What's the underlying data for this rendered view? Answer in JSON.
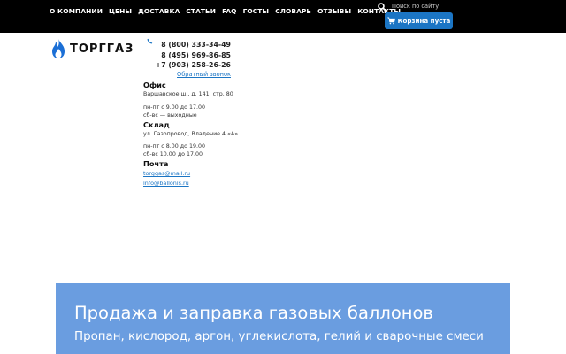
{
  "nav": {
    "items": [
      {
        "label": "О КОМПАНИИ"
      },
      {
        "label": "ЦЕНЫ"
      },
      {
        "label": "ДОСТАВКА"
      },
      {
        "label": "СТАТЬИ"
      },
      {
        "label": "FAQ"
      },
      {
        "label": "ГОСТЫ"
      },
      {
        "label": "СЛОВАРЬ"
      },
      {
        "label": "ОТЗЫВЫ"
      },
      {
        "label": "КОНТАКТЫ"
      }
    ]
  },
  "search": {
    "placeholder": "Поиск по сайту",
    "icon": "search-icon"
  },
  "cart": {
    "label": "Корзина пуста",
    "icon": "cart-icon",
    "color": "#1b75c4"
  },
  "logo": {
    "text": "ТОРГГАЗ",
    "icon": "flame-icon"
  },
  "contacts": {
    "phones": [
      "8 (800) 333-34-49",
      "8 (495) 969-86-85",
      "+7 (903) 258-26-26"
    ],
    "callback": "Обратный звонок",
    "office": {
      "title": "Офис",
      "address": "Варшавское ш., д. 141, стр. 80",
      "hours1": "пн-пт с 9.00 до 17.00",
      "hours2": "сб-вс — выходные"
    },
    "warehouse": {
      "title": "Склад",
      "address": "ул. Газопровод, Владение 4 «А»",
      "hours1": "пн-пт с 8.00 до 19.00",
      "hours2": "сб-вс 10.00 до 17.00"
    },
    "mail": {
      "title": "Почта",
      "emails": [
        "torggas@mail.ru",
        "info@ballonis.ru"
      ]
    }
  },
  "hero": {
    "title": "Продажа и заправка газовых баллонов",
    "subtitle": "Пропан, кислород, аргон, углекислота, гелий и сварочные смеси",
    "color": "#6a9de0"
  }
}
